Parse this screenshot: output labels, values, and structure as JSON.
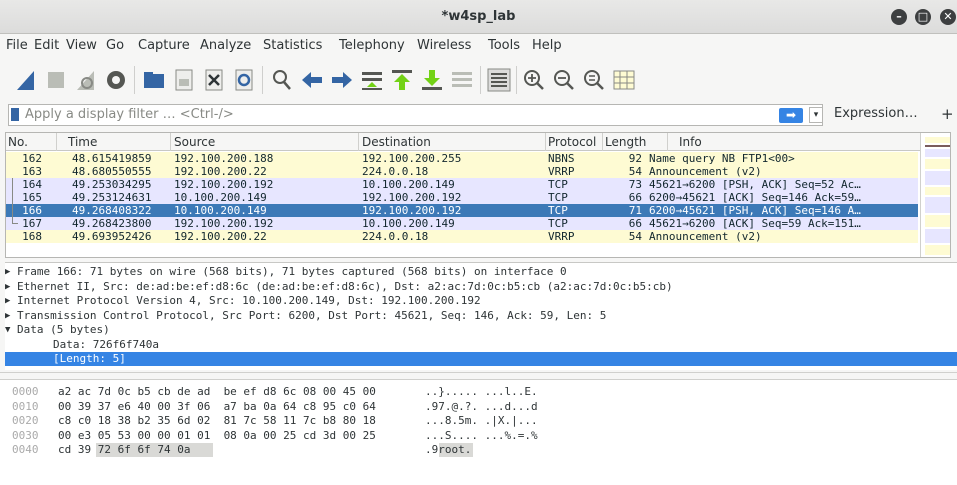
{
  "window": {
    "title": "*w4sp_lab",
    "controls": [
      "minimize",
      "maximize",
      "close"
    ]
  },
  "menu": [
    "File",
    "Edit",
    "View",
    "Go",
    "Capture",
    "Analyze",
    "Statistics",
    "Telephony",
    "Wireless",
    "Tools",
    "Help"
  ],
  "toolbar_icons": [
    "shark-fin-start-icon",
    "stop-icon",
    "restart-icon",
    "options-gear-icon",
    "open-folder-icon",
    "save-file-icon",
    "close-file-icon",
    "reload-icon",
    "find-icon",
    "go-back-icon",
    "go-forward-icon",
    "go-to-packet-icon",
    "go-first-icon",
    "go-last-icon",
    "auto-scroll-icon",
    "colorize-icon",
    "zoom-in-icon",
    "zoom-out-icon",
    "zoom-reset-icon",
    "resize-columns-icon"
  ],
  "filter": {
    "placeholder": "Apply a display filter … <Ctrl-/>",
    "apply_glyph": "➡",
    "dropdown_glyph": "▾",
    "expression_label": "Expression…",
    "plus_label": "+"
  },
  "packet_list": {
    "columns": [
      "No.",
      "Time",
      "Source",
      "Destination",
      "Protocol",
      "Length",
      "Info"
    ],
    "rows": [
      {
        "no": "162",
        "time": "48.615419859",
        "src": "192.100.200.188",
        "dst": "192.100.200.255",
        "proto": "NBNS",
        "len": "92",
        "info": "Name query NB FTP1<00>",
        "bg": "#fefbd3",
        "fg": "#12272e"
      },
      {
        "no": "163",
        "time": "48.680550555",
        "src": "192.100.200.22",
        "dst": "224.0.0.18",
        "proto": "VRRP",
        "len": "54",
        "info": "Announcement (v2)",
        "bg": "#fefbd3",
        "fg": "#12272e"
      },
      {
        "no": "164",
        "time": "49.253034295",
        "src": "192.100.200.192",
        "dst": "10.100.200.149",
        "proto": "TCP",
        "len": "73",
        "info": "45621→6200 [PSH, ACK] Seq=52 Ac…",
        "bg": "#e7e6ff",
        "fg": "#12272e"
      },
      {
        "no": "165",
        "time": "49.253124631",
        "src": "10.100.200.149",
        "dst": "192.100.200.192",
        "proto": "TCP",
        "len": "66",
        "info": "6200→45621 [ACK] Seq=146 Ack=59…",
        "bg": "#e7e6ff",
        "fg": "#12272e"
      },
      {
        "no": "166",
        "time": "49.268408322",
        "src": "10.100.200.149",
        "dst": "192.100.200.192",
        "proto": "TCP",
        "len": "71",
        "info": "6200→45621 [PSH, ACK] Seq=146 A…",
        "bg": "#3c79b7",
        "fg": "#ffffff"
      },
      {
        "no": "167",
        "time": "49.268423800",
        "src": "192.100.200.192",
        "dst": "10.100.200.149",
        "proto": "TCP",
        "len": "66",
        "info": "45621→6200 [ACK] Seq=59 Ack=151…",
        "bg": "#e7e6ff",
        "fg": "#12272e"
      },
      {
        "no": "168",
        "time": "49.693952426",
        "src": "192.100.200.22",
        "dst": "224.0.0.18",
        "proto": "VRRP",
        "len": "54",
        "info": "Announcement (v2)",
        "bg": "#fefbd3",
        "fg": "#12272e"
      }
    ]
  },
  "details": [
    {
      "text": "Frame 166: 71 bytes on wire (568 bits), 71 bytes captured (568 bits) on interface 0",
      "indent": 0,
      "expanded": false
    },
    {
      "text": "Ethernet II, Src: de:ad:be:ef:d8:6c (de:ad:be:ef:d8:6c), Dst: a2:ac:7d:0c:b5:cb (a2:ac:7d:0c:b5:cb)",
      "indent": 0,
      "expanded": false
    },
    {
      "text": "Internet Protocol Version 4, Src: 10.100.200.149, Dst: 192.100.200.192",
      "indent": 0,
      "expanded": false
    },
    {
      "text": "Transmission Control Protocol, Src Port: 6200, Dst Port: 45621, Seq: 146, Ack: 59, Len: 5",
      "indent": 0,
      "expanded": false
    },
    {
      "text": "Data (5 bytes)",
      "indent": 0,
      "expanded": true
    },
    {
      "text": "Data: 726f6f740a",
      "indent": 1
    },
    {
      "text": "[Length: 5]",
      "indent": 1,
      "selected": true
    }
  ],
  "bytes": [
    {
      "offset": "0000",
      "hex": "a2 ac 7d 0c b5 cb de ad  be ef d8 6c 08 00 45 00",
      "ascii": "..}..... ...l..E."
    },
    {
      "offset": "0010",
      "hex": "00 39 37 e6 40 00 3f 06  a7 ba 0a 64 c8 95 c0 64",
      "ascii": ".97.@.?. ...d...d"
    },
    {
      "offset": "0020",
      "hex": "c8 c0 18 38 b2 35 6d 02  81 7c 58 11 7c b8 80 18",
      "ascii": "...8.5m. .|X.|..."
    },
    {
      "offset": "0030",
      "hex": "00 e3 05 53 00 00 01 01  08 0a 00 25 cd 3d 00 25",
      "ascii": "...S.... ...%.=.%"
    },
    {
      "offset": "0040",
      "hex": "cd 39 72 6f 6f 74 0a",
      "ascii": ".9root."
    }
  ],
  "colors": {
    "selected_row": "#3c79b7",
    "selected_detail": "#3584e4",
    "tcp_row": "#e7e6ff",
    "udp_row": "#fefbd3"
  }
}
